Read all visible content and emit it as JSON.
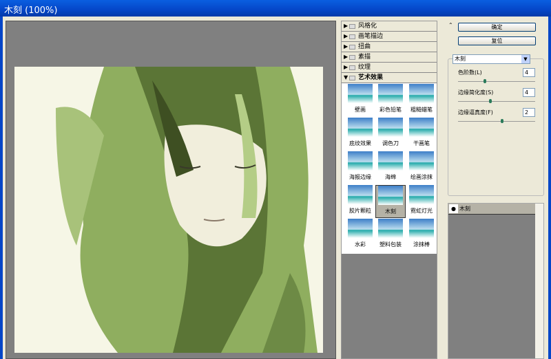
{
  "window": {
    "title": "木刻 (100%)"
  },
  "categories": [
    {
      "label": "风格化",
      "expanded": false
    },
    {
      "label": "画笔描边",
      "expanded": false
    },
    {
      "label": "扭曲",
      "expanded": false
    },
    {
      "label": "素描",
      "expanded": false
    },
    {
      "label": "纹理",
      "expanded": false
    },
    {
      "label": "艺术效果",
      "expanded": true
    }
  ],
  "filters": [
    {
      "label": "壁画"
    },
    {
      "label": "彩色铅笔"
    },
    {
      "label": "粗糙蜡笔"
    },
    {
      "label": "底纹效果"
    },
    {
      "label": "调色刀"
    },
    {
      "label": "干画笔"
    },
    {
      "label": "海报边缘"
    },
    {
      "label": "海绵"
    },
    {
      "label": "绘画涂抹"
    },
    {
      "label": "胶片颗粒"
    },
    {
      "label": "木刻",
      "selected": true
    },
    {
      "label": "霓虹灯光"
    },
    {
      "label": "水彩"
    },
    {
      "label": "塑料包装"
    },
    {
      "label": "涂抹棒"
    }
  ],
  "buttons": {
    "ok": "确定",
    "reset": "复位"
  },
  "filter_select": {
    "value": "木刻"
  },
  "params": [
    {
      "label": "色阶数(L)",
      "value": "4",
      "slider_fraction": 0.33
    },
    {
      "label": "边缘简化度(S)",
      "value": "4",
      "slider_fraction": 0.4
    },
    {
      "label": "边缘逼真度(F)",
      "value": "2",
      "slider_fraction": 0.55
    }
  ],
  "layers": [
    {
      "label": "木刻",
      "visible": true
    }
  ],
  "colors": {
    "titlebar": "#0546c8",
    "dialog": "#ece9d8",
    "preview_bg": "#808080"
  }
}
